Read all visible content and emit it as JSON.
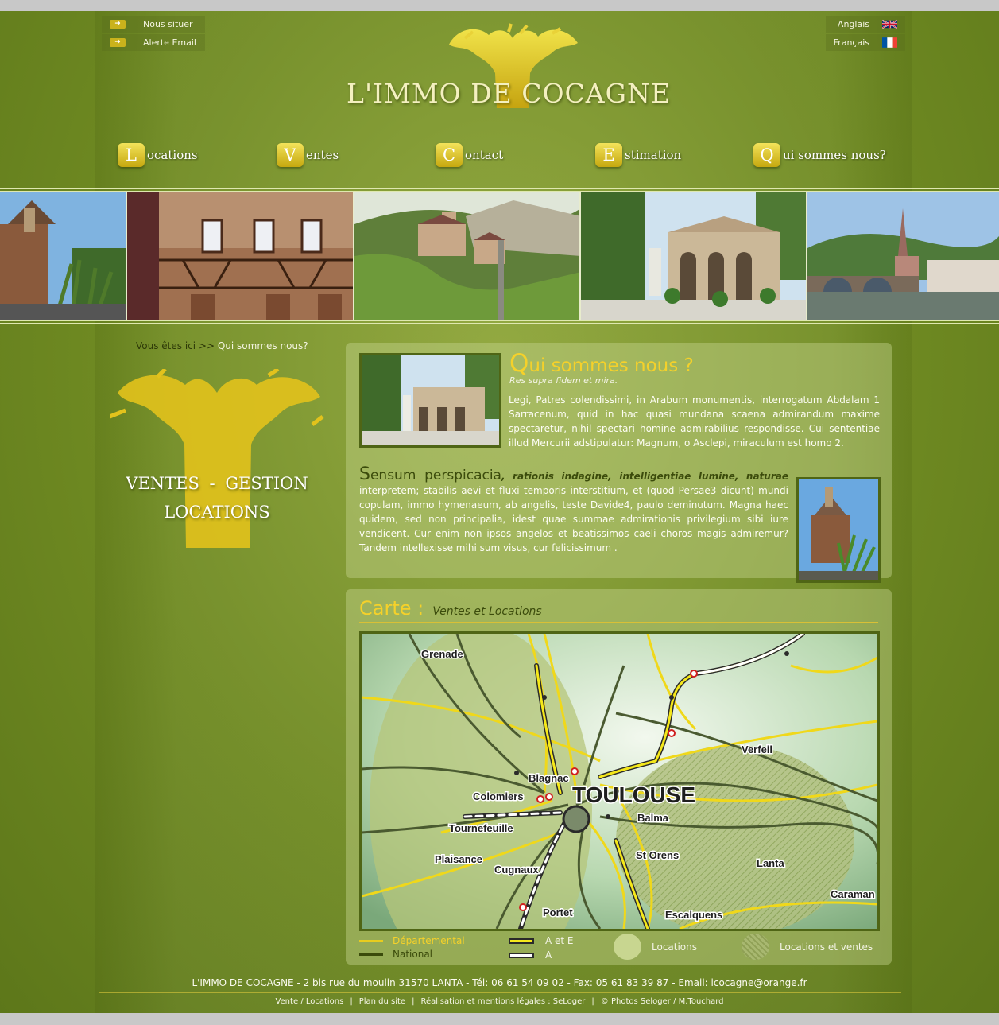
{
  "header": {
    "top_links": [
      "Nous situer",
      "Alerte Email"
    ],
    "languages": [
      "Anglais",
      "Français"
    ],
    "logo_text": "L'IMMO DE COCAGNE"
  },
  "nav": [
    {
      "initial": "L",
      "rest": "ocations"
    },
    {
      "initial": "V",
      "rest": "entes"
    },
    {
      "initial": "C",
      "rest": "ontact"
    },
    {
      "initial": "E",
      "rest": "stimation"
    },
    {
      "initial": "Q",
      "rest": "ui sommes nous?"
    }
  ],
  "breadcrumb": {
    "prefix": "Vous êtes ici >>",
    "current": "Qui sommes nous?"
  },
  "side_logo": {
    "line1": "VENTES - GESTION",
    "line2": "LOCATIONS"
  },
  "about": {
    "title_initial": "Q",
    "title_rest": "ui sommes nous ?",
    "subtitle": "Res supra fidem et mira.",
    "paragraph1": "Legi, Patres colendissimi, in Arabum monumentis, interrogatum Abdalam 1 Sarracenum, quid in hac quasi mundana scaena admirandum maxime spectaretur, nihil spectari homine admirabilius respondisse. Cui sententiae illud Mercurii adstipulatur: Magnum, o Asclepi, miraculum est homo 2.",
    "section_initial": "S",
    "section_rest": "ensum perspicacia",
    "lead": ", rationis indagine, intelligentiae lumine, naturae",
    "paragraph2": " interpretem; stabilis aevi et fluxi temporis interstitium, et (quod Persae3 dicunt) mundi copulam, immo hymenaeum, ab angelis, teste Davide4, paulo deminutum. Magna haec quidem, sed non principalia, idest quae summae admirationis privilegium sibi iure vendicent. Cur enim non ipsos angelos et beatissimos caeli choros magis admiremur? Tandem intellexisse mihi sum visus, cur felicissimum ."
  },
  "map_section": {
    "title": "Carte :",
    "subtitle": "Ventes et Locations",
    "places": [
      "Grenade",
      "Verfeil",
      "Blagnac",
      "Colomiers",
      "TOULOUSE",
      "Balma",
      "Tournefeuille",
      "Plaisance",
      "St Orens",
      "Lanta",
      "Cugnaux",
      "Caraman",
      "Portet",
      "Escalquens"
    ],
    "legend": {
      "departemental": "Départemental",
      "national": "National",
      "a_et_e": "A et E",
      "a": "A",
      "locations": "Locations",
      "locations_ventes": "Locations et ventes"
    }
  },
  "footer": {
    "address": "L'IMMO DE COCAGNE - 2 bis rue du moulin  31570   LANTA - Tél: 06 61 54 09 02 - Fax: 05 61 83 39 87 - Email: icocagne@orange.fr",
    "links": [
      "Vente / Locations",
      "Plan du site",
      "Réalisation et mentions légales : SeLoger",
      "© Photos Seloger / M.Touchard"
    ]
  },
  "colors": {
    "accent": "#f5d12a",
    "background": "#6f8a22",
    "dark_text": "#3b4b0b"
  }
}
